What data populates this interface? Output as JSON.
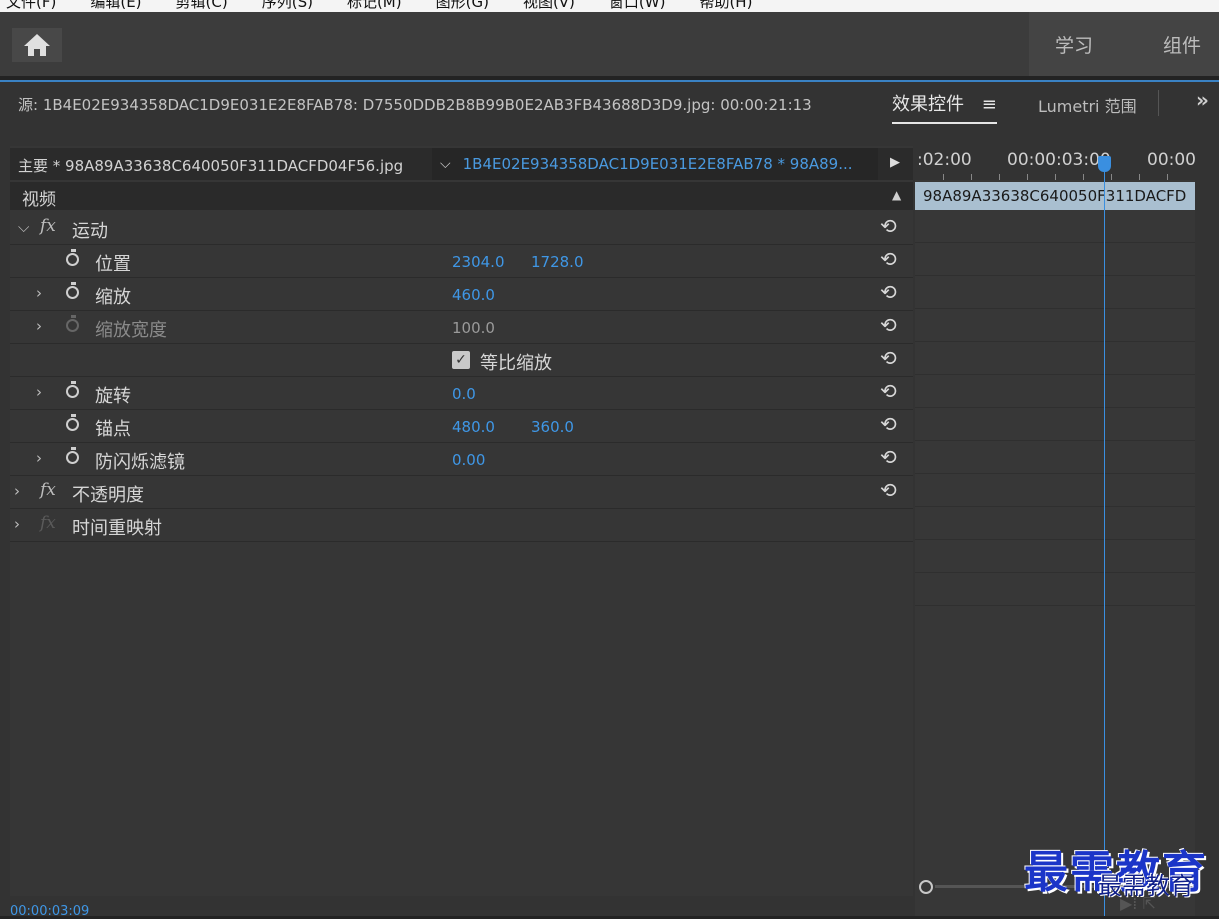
{
  "menubar": {
    "items": [
      "文件(F)",
      "编辑(E)",
      "剪辑(C)",
      "序列(S)",
      "标记(M)",
      "图形(G)",
      "视图(V)",
      "窗口(W)",
      "帮助(H)"
    ]
  },
  "workspaces": {
    "learn": "学习",
    "assembly": "组件"
  },
  "panel": {
    "source_title": "源: 1B4E02E934358DAC1D9E031E2E8FAB78: D7550DDB2B8B99B0E2AB3FB43688D3D9.jpg: 00:00:21:13",
    "tab_effects": "效果控件",
    "tab_effects_menu": "≡",
    "tab_lumetri": "Lumetri 范围",
    "more": "»"
  },
  "clip_bar": {
    "master": "主要 * 98A89A33638C640050F311DACFD04F56.jpg",
    "sequence": "1B4E02E934358DAC1D9E031E2E8FAB78 * 98A89..."
  },
  "video_header": "视频",
  "effects": {
    "motion": "运动",
    "position": {
      "label": "位置",
      "x": "2304.0",
      "y": "1728.0"
    },
    "scale": {
      "label": "缩放",
      "value": "460.0"
    },
    "scale_width": {
      "label": "缩放宽度",
      "value": "100.0"
    },
    "uniform_scale": {
      "label": "等比缩放",
      "checked": true
    },
    "rotation": {
      "label": "旋转",
      "value": "0.0"
    },
    "anchor": {
      "label": "锚点",
      "x": "480.0",
      "y": "360.0"
    },
    "antiflicker": {
      "label": "防闪烁滤镜",
      "value": "0.00"
    },
    "opacity": "不透明度",
    "time_remap": "时间重映射"
  },
  "timeline": {
    "tc1": ":02:00",
    "tc2": "00:00:03:00",
    "tc3": "00:00",
    "clip": "98A89A33638C640050F311DACFD"
  },
  "current_timecode": "00:00:03:09",
  "watermark": {
    "big": "最需教育",
    "small": "最需教育"
  },
  "colors": {
    "accent": "#3f97e6",
    "panel": "#333333",
    "clip": "#a9bfd0"
  }
}
